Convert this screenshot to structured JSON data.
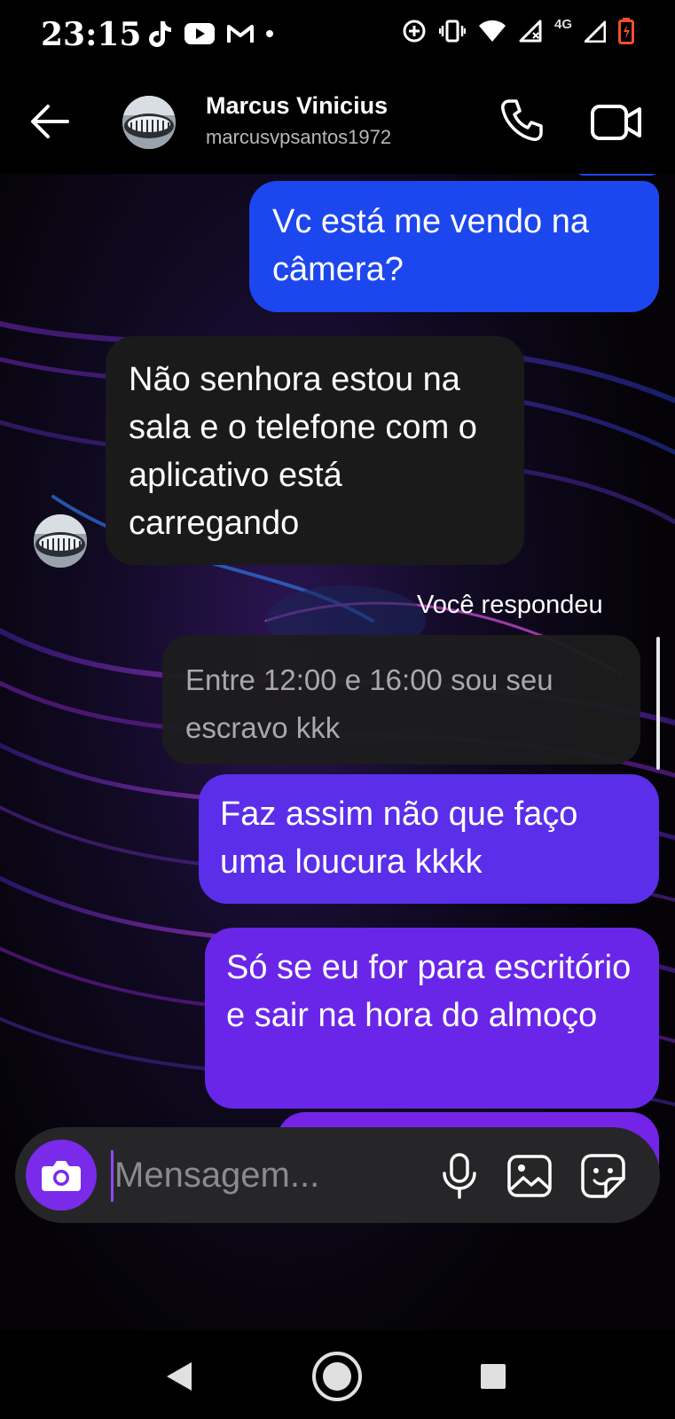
{
  "status_bar": {
    "time": "23:15",
    "network_label": "4G"
  },
  "header": {
    "name": "Marcus Vinicius",
    "username": "marcusvpsantos1972"
  },
  "messages": [
    {
      "sender": "me",
      "text": "Vc está me vendo na câmera?"
    },
    {
      "sender": "contact",
      "text": "Não senhora estou na sala e o telefone com o aplicativo está carregando"
    },
    {
      "sender": "me",
      "type": "reply_context",
      "label": "Você respondeu",
      "quoted_text": "Entre 12:00 e 16:00 sou seu escravo kkk"
    },
    {
      "sender": "me",
      "text": "Faz assim não que faço uma loucura kkkk"
    },
    {
      "sender": "me",
      "text": "Só se eu for para escritório e sair na hora do almoço"
    }
  ],
  "composer": {
    "placeholder": "Mensagem..."
  },
  "icons": {
    "back": "back-arrow-icon",
    "call": "phone-icon",
    "video": "video-camera-icon",
    "camera": "camera-icon",
    "mic": "microphone-icon",
    "gallery": "image-icon",
    "sticker": "sticker-icon"
  },
  "colors": {
    "sent_blue": "#1d47ee",
    "sent_purple": "#6a26e8",
    "received": "#1a1a1b",
    "accent": "#7a2bea"
  }
}
